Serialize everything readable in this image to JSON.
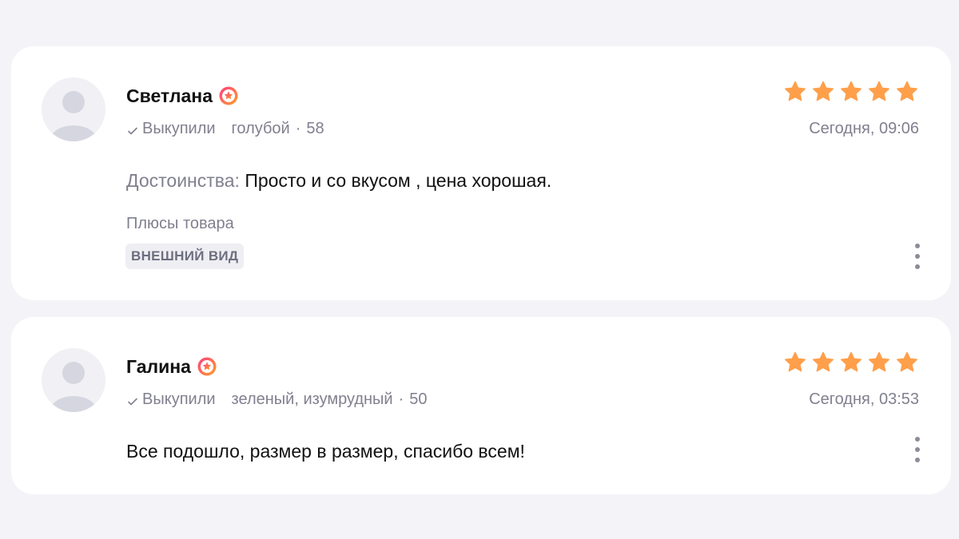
{
  "reviews": [
    {
      "author": "Светлана",
      "badge_icon": "star-badge-icon",
      "purchased_label": "Выкупили",
      "variant": "голубой",
      "size": "58",
      "date": "Сегодня, 09:06",
      "rating": 5,
      "advantages_label": "Достоинства:",
      "advantages_text": "Просто и со вкусом , цена хорошая.",
      "pros_heading": "Плюсы товара",
      "pros_tags": [
        "ВНЕШНИЙ ВИД"
      ]
    },
    {
      "author": "Галина",
      "badge_icon": "star-badge-icon",
      "purchased_label": "Выкупили",
      "variant": "зеленый, изумрудный",
      "size": "50",
      "date": "Сегодня, 03:53",
      "rating": 5,
      "text": "Все подошло, размер в размер, спасибо всем!"
    }
  ],
  "colors": {
    "star": "#ff9f4a",
    "badge_start": "#ff3d7f",
    "badge_end": "#ff9f2a",
    "muted_text": "#80808f"
  },
  "separator": "·"
}
